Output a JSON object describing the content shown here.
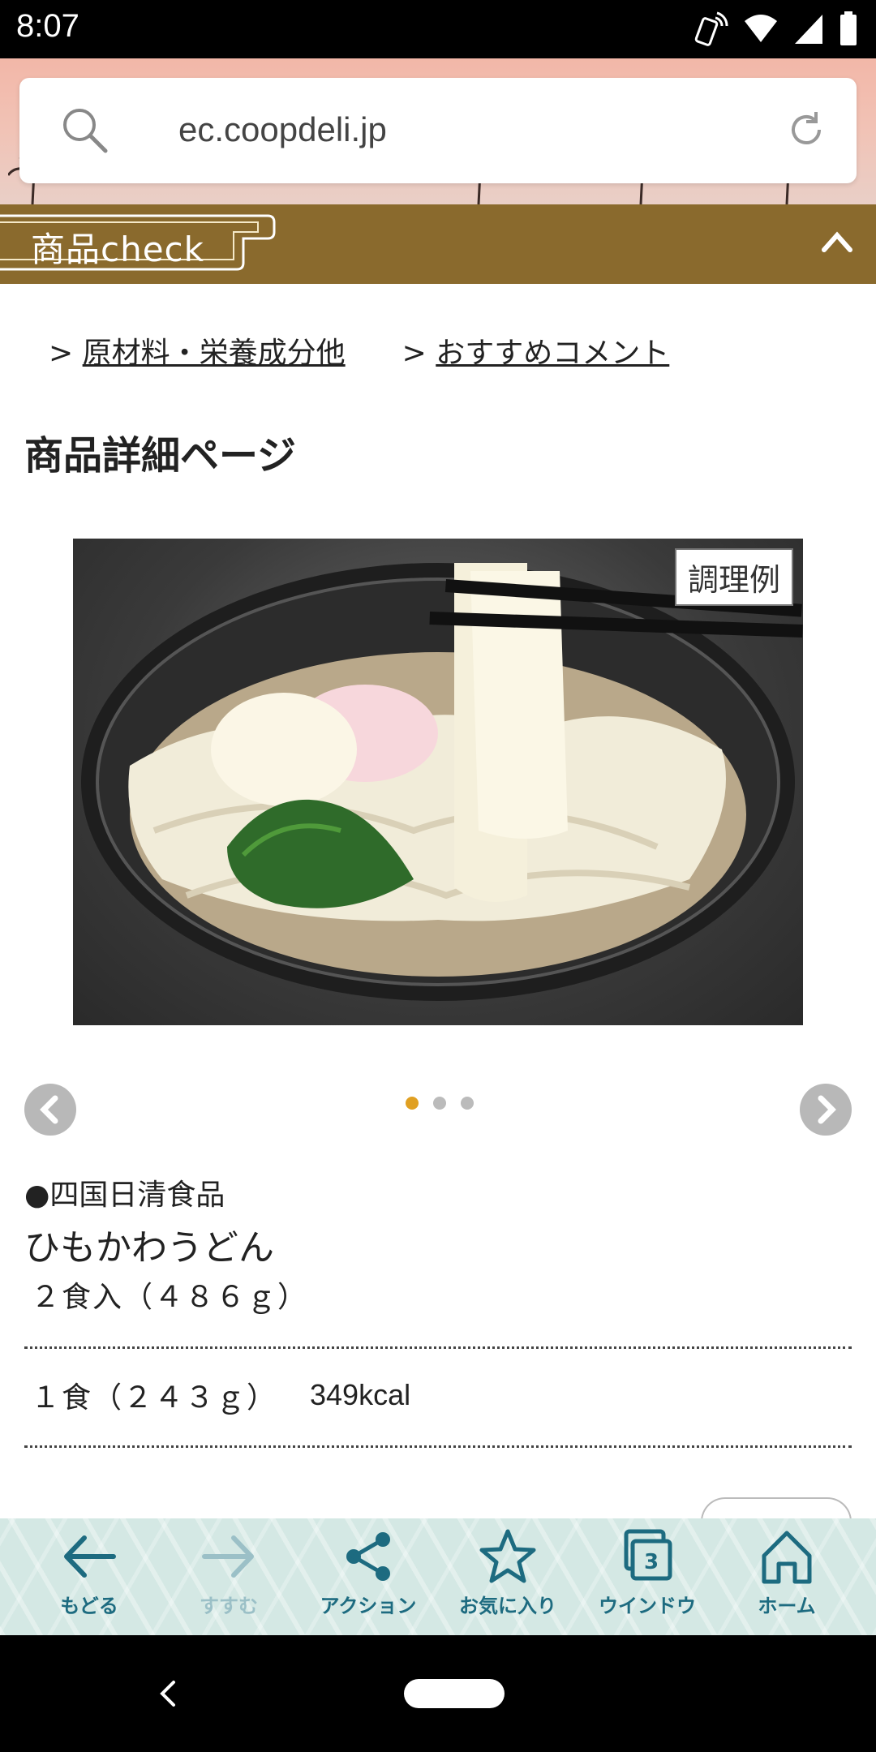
{
  "status_bar": {
    "time": "8:07"
  },
  "browser": {
    "url": "ec.coopdeli.jp"
  },
  "section": {
    "label": "商品check"
  },
  "anchors": [
    {
      "prefix": ">",
      "label": "原材料・栄養成分他"
    },
    {
      "prefix": ">",
      "label": "おすすめコメント"
    }
  ],
  "page": {
    "title": "商品詳細ページ"
  },
  "image": {
    "tag": "調理例"
  },
  "carousel": {
    "total": 3,
    "active_index": 0
  },
  "product": {
    "maker": "●四国日清食品",
    "name": "ひもかわうどん",
    "quantity": "２食入（４８６ｇ）",
    "serving": "１食（２４３ｇ）",
    "calories": "349kcal"
  },
  "toolbar": {
    "back": "もどる",
    "forward": "すすむ",
    "action": "アクション",
    "favorite": "お気に入り",
    "window": "ウインドウ",
    "window_count": "3",
    "home": "ホーム"
  },
  "colors": {
    "band": "#8a6a2d",
    "toolbar_icon": "#1d6b80",
    "dot_active": "#e0a022"
  }
}
